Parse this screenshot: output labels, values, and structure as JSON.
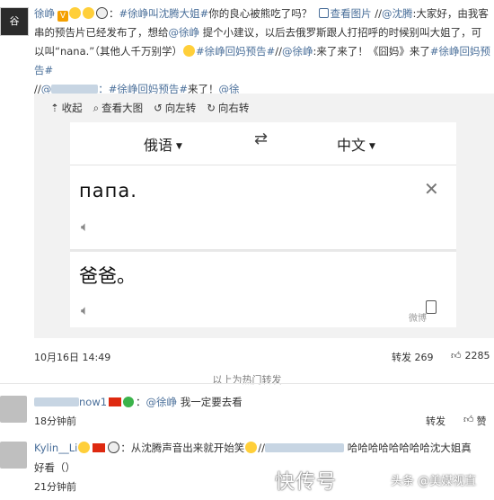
{
  "post": {
    "avatar_text": "谷",
    "author": "徐峥",
    "line1_after_emoji": "：",
    "topic1": "#徐峥叫沈腾大姐#",
    "line1_text": "你的良心被熊吃了吗？",
    "view_pic": "查看图片",
    "repost_prefix": "//",
    "mention_shenteng": "@沈腾",
    "line1_tail": ":大家好，由我客",
    "line2": "串的预告片已经发布了，想给",
    "mention_xuzheng": "@徐峥",
    "line2_tail": " 提个小建议，以后去俄罗斯跟人打招呼的时候别叫大姐了，可",
    "line3_head": "以叫“nana.”（其他人千万别学）",
    "topic2": "#徐峥回妈预告#",
    "line3_sep": "//",
    "mention3": "@徐峥",
    "line3_tail": ":来了来了！《囧妈》来了",
    "topic3": "#徐峥回妈预告#",
    "line4_head": "//",
    "mention4_prefix": "@",
    "mention4_suffix": "：",
    "topic4": "#徐峥回妈预告#",
    "line4_mid": "来了！",
    "mention5": "@徐"
  },
  "toolbar": {
    "collapse": "收起",
    "view_large": "查看大图",
    "rotate_left": "向左转",
    "rotate_right": "向右转"
  },
  "translator": {
    "source_lang": "俄语",
    "target_lang": "中文",
    "source_text": "папа.",
    "target_text": "爸爸。",
    "watermark": "微博"
  },
  "meta": {
    "date": "10月16日 14:49",
    "repost_label": "转发 269",
    "like_count": "2285",
    "hot_repost_label": "以上为热门转发"
  },
  "comments": [
    {
      "user_suffix": "now1",
      "mention": "@徐峥",
      "text": "我一定要去看",
      "time": "18分钟前",
      "repost": "转发",
      "like": "赞"
    },
    {
      "user": "Kylin__Li",
      "text_head": "：从沈腾声音出来就开始笑",
      "text_tail": "哈哈哈哈哈哈哈哈沈大姐真",
      "text_line2": "好看（）",
      "time": "21分钟前"
    }
  ],
  "overlay": {
    "watermark_main": "快传号",
    "watermark_sub": "头条 @美媒视直"
  }
}
